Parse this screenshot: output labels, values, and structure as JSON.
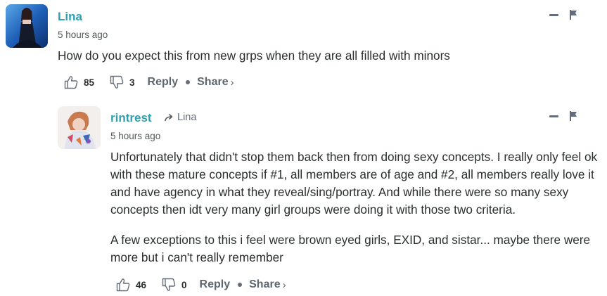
{
  "comments": [
    {
      "username": "Lina",
      "timestamp": "5 hours ago",
      "body": [
        "How do you expect this from new grps when they are all filled with minors"
      ],
      "upvotes": "85",
      "downvotes": "3",
      "reply_label": "Reply",
      "share_label": "Share",
      "share_chevron": "›"
    },
    {
      "username": "rintrest",
      "reply_to": "Lina",
      "timestamp": "5 hours ago",
      "body": [
        "Unfortunately that didn't stop them back then from doing sexy concepts. I really only feel ok with these mature concepts if #1, all members are of age and #2, all members really love it and have agency in what they reveal/sing/portray. And while there were so many sexy concepts then idt very many girl groups were doing it with those two criteria.",
        "A few exceptions to this i feel were brown eyed girls, EXID, and sistar... maybe there were more but i can't really remember"
      ],
      "upvotes": "46",
      "downvotes": "0",
      "reply_label": "Reply",
      "share_label": "Share",
      "share_chevron": "›"
    }
  ],
  "icons": {
    "upvote": "thumbs-up-icon",
    "downvote": "thumbs-down-icon",
    "collapse": "minus-icon",
    "flag": "flag-icon",
    "reply_to": "reply-arrow-icon"
  },
  "colors": {
    "username": "#2e9fae",
    "text": "#2a2e2e",
    "muted": "#656c7a"
  }
}
